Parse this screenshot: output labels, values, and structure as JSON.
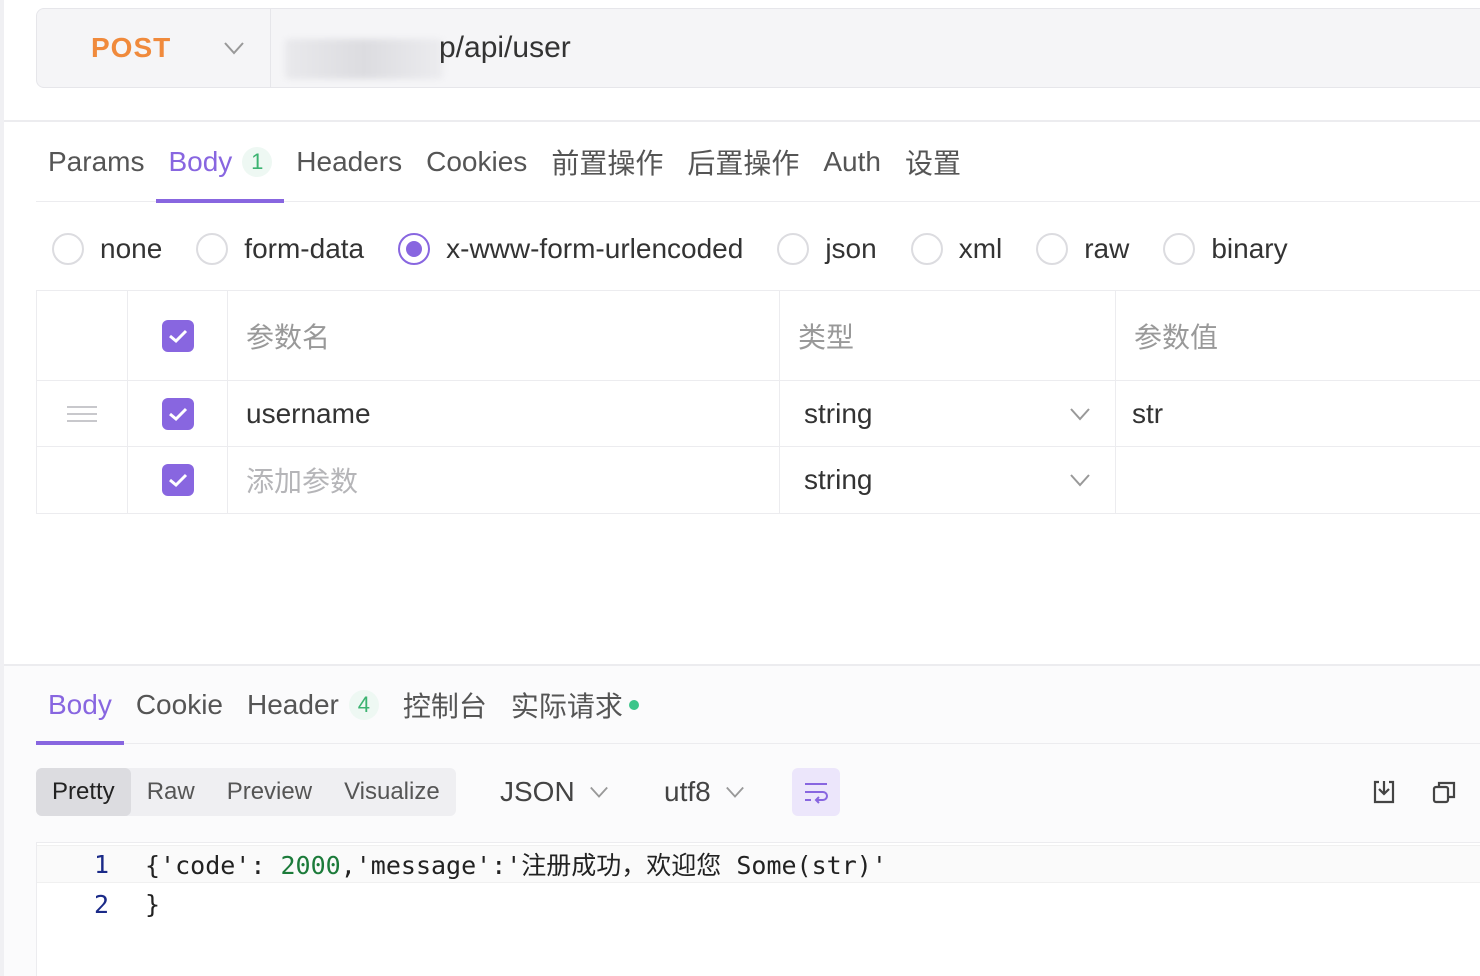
{
  "request": {
    "method": "POST",
    "url_visible": "p/api/user"
  },
  "req_tabs": [
    {
      "label": "Params"
    },
    {
      "label": "Body",
      "badge": "1",
      "active": true
    },
    {
      "label": "Headers"
    },
    {
      "label": "Cookies"
    },
    {
      "label": "前置操作"
    },
    {
      "label": "后置操作"
    },
    {
      "label": "Auth"
    },
    {
      "label": "设置"
    }
  ],
  "body_types": {
    "options": [
      "none",
      "form-data",
      "x-www-form-urlencoded",
      "json",
      "xml",
      "raw",
      "binary"
    ],
    "selected": "x-www-form-urlencoded"
  },
  "params_table": {
    "headers": {
      "name": "参数名",
      "type": "类型",
      "value": "参数值"
    },
    "rows": [
      {
        "name": "username",
        "type": "string",
        "value": "str",
        "checked": true
      },
      {
        "name_placeholder": "添加参数",
        "type": "string",
        "value": "",
        "checked": true
      }
    ]
  },
  "resp_tabs": [
    {
      "label": "Body",
      "active": true
    },
    {
      "label": "Cookie"
    },
    {
      "label": "Header",
      "badge": "4"
    },
    {
      "label": "控制台"
    },
    {
      "label": "实际请求",
      "dot": true
    }
  ],
  "view_modes": [
    "Pretty",
    "Raw",
    "Preview",
    "Visualize"
  ],
  "view_selected": "Pretty",
  "format": "JSON",
  "encoding": "utf8",
  "code": {
    "line1_no": "1",
    "line1_open": "{'code': ",
    "line1_num": "2000",
    "line1_rest": ",'message':'注册成功，欢迎您 Some(str)'",
    "line2_no": "2",
    "line2_text": "}"
  },
  "colors": {
    "accent": "#8866e0",
    "method": "#f08a3c",
    "badge": "#3cb371"
  }
}
